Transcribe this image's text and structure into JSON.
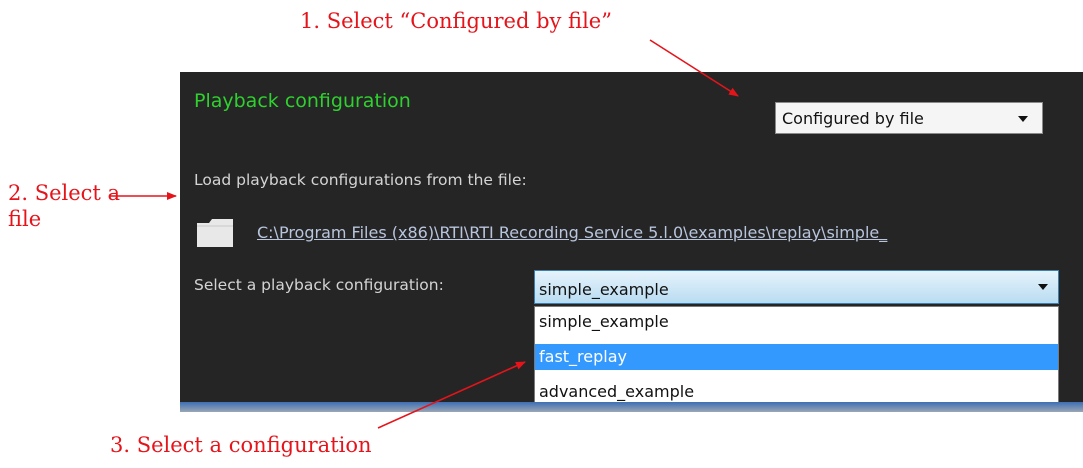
{
  "annotations": {
    "step1": "1. Select “Configured by file”",
    "step2_line1": "2. Select a",
    "step2_line2": "file",
    "step3": "3. Select a configuration"
  },
  "panel": {
    "title": "Playback configuration",
    "mode_select": {
      "value": "Configured by file"
    },
    "load_label": "Load playback configurations from the file:",
    "file_path": "C:\\Program Files (x86)\\RTI\\RTI Recording Service 5.l.0\\examples\\replay\\simple_",
    "select_label": "Select a playback configuration:",
    "config_select": {
      "value": "simple_example",
      "options": [
        "simple_example",
        "fast_replay",
        "advanced_example"
      ],
      "highlighted_index": 1
    }
  },
  "colors": {
    "annotation": "#e5141b",
    "title": "#2fd12f",
    "panel_bg": "#252525",
    "highlight": "#3399ff"
  },
  "icons": {
    "folder": "folder-icon",
    "dropdown": "chevron-down-icon"
  }
}
